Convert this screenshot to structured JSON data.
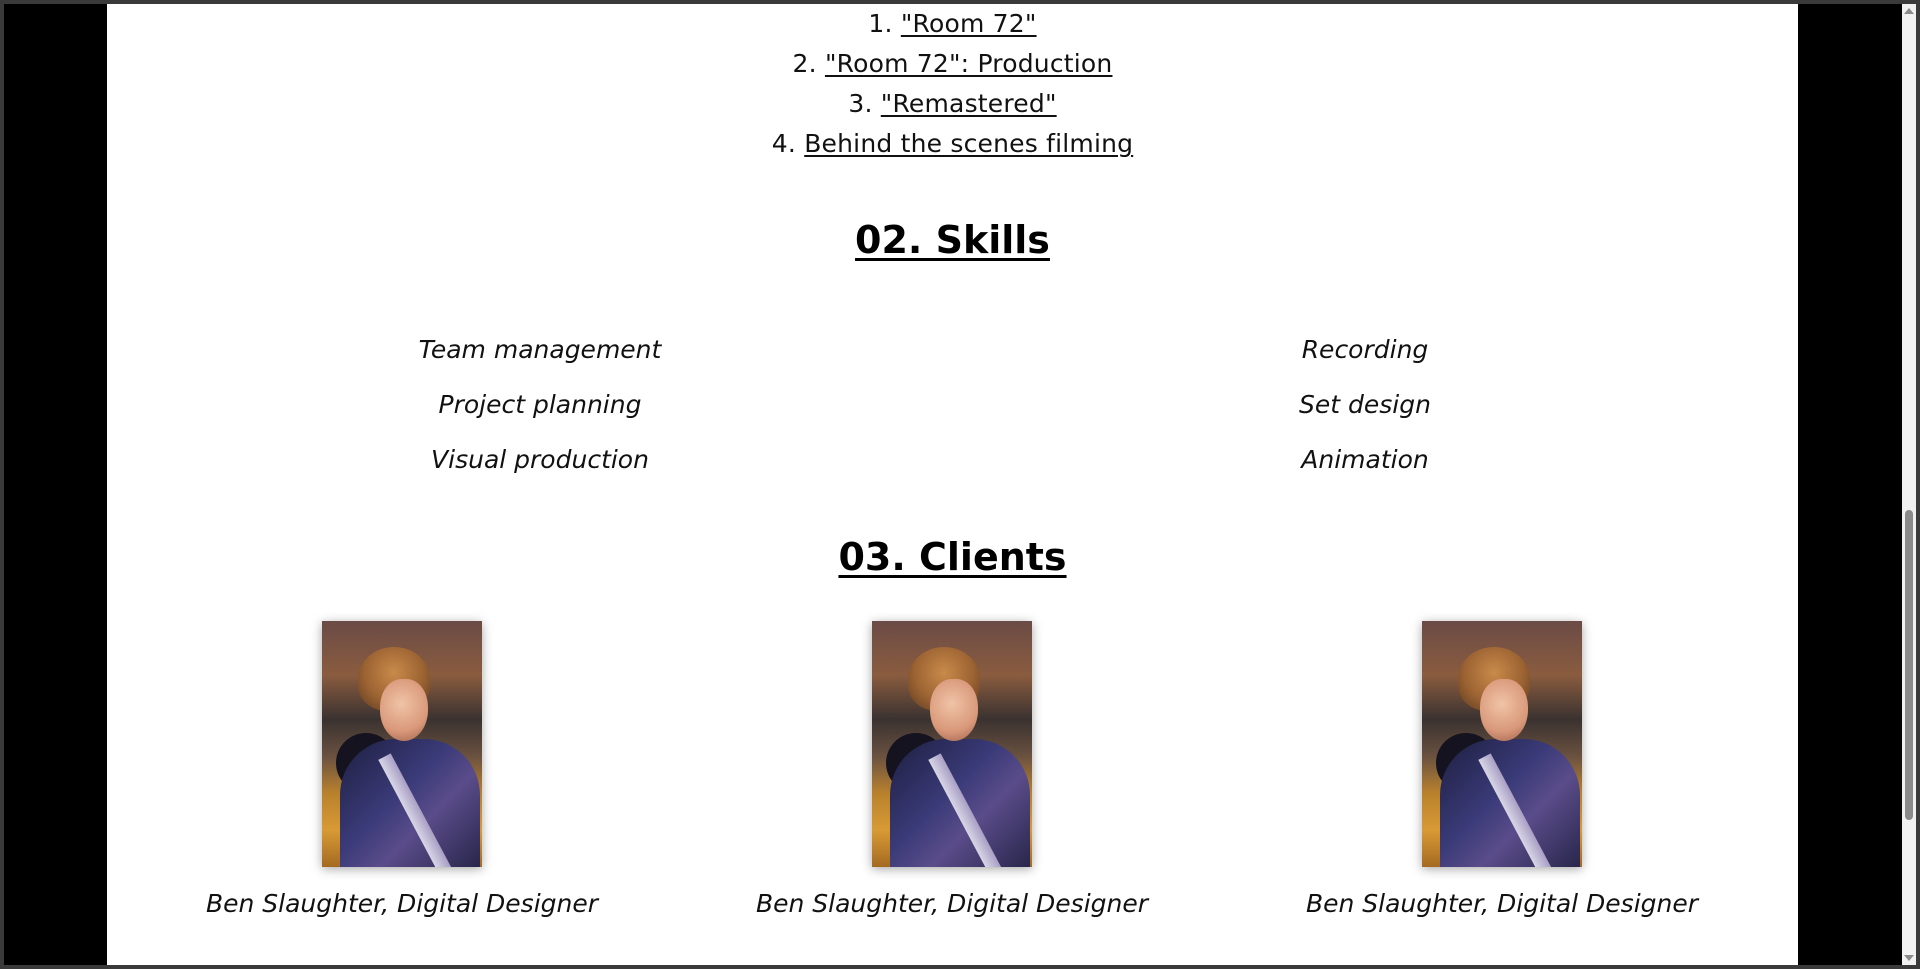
{
  "works": {
    "items": [
      {
        "number": "1.",
        "label": "\"Room 72\""
      },
      {
        "number": "2.",
        "label": "\"Room 72\": Production"
      },
      {
        "number": "3.",
        "label": "\"Remastered\""
      },
      {
        "number": "4.",
        "label": "Behind the scenes filming"
      }
    ]
  },
  "skills": {
    "title": "02. Skills",
    "left": [
      "Team management",
      "Project planning",
      "Visual production"
    ],
    "right": [
      "Recording",
      "Set design",
      "Animation"
    ]
  },
  "clients": {
    "title": "03. Clients",
    "items": [
      {
        "caption": "Ben Slaughter, Digital Designer"
      },
      {
        "caption": "Ben Slaughter, Digital Designer"
      },
      {
        "caption": "Ben Slaughter, Digital Designer"
      }
    ]
  }
}
